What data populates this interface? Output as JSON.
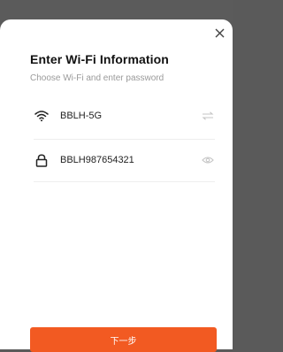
{
  "dialog": {
    "title": "Enter Wi-Fi Information",
    "subtitle": "Choose Wi-Fi and enter password"
  },
  "wifi": {
    "ssid": "BBLH-5G",
    "icon": "wifi-icon",
    "switch_icon": "switch-network-icon"
  },
  "password": {
    "value": "BBLH987654321",
    "icon": "lock-icon",
    "toggle_icon": "eye-icon"
  },
  "actions": {
    "next_label": "下一步",
    "close_icon": "close-icon"
  },
  "colors": {
    "accent": "#f25a22",
    "overlay": "#5a5a5a"
  }
}
